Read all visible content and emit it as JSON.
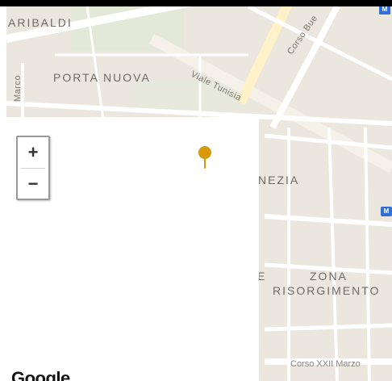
{
  "map": {
    "labels": {
      "garibaldi": "ARIBALDI",
      "porta_nuova": "PORTA NUOVA",
      "venezia": "NEZIA",
      "zona": "ZONA",
      "risorgimento": "RISORGIMENTO",
      "viale_tunisia": "Viale Tunisia",
      "corso_buenos": "Corso Bue",
      "left_fragment": "Marco",
      "corso_xxii_marzo": "Corso XXII Marzo",
      "road_e": "E"
    },
    "metro_badge": "M",
    "attribution": "Google",
    "marker_color": "#d99a0a",
    "zoom_controls": {
      "zoom_in": "+",
      "zoom_out": "−"
    }
  }
}
